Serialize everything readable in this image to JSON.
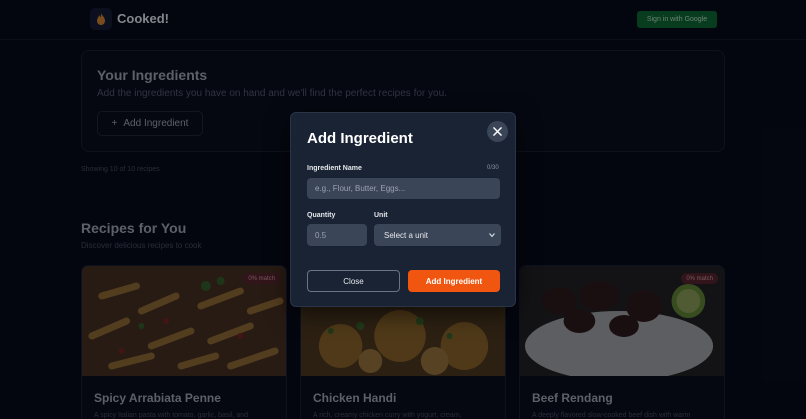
{
  "app": {
    "brand": "Cooked!",
    "signin_label": "Sign in with Google"
  },
  "ingredients": {
    "title": "Your Ingredients",
    "subtitle": "Add the ingredients you have on hand and we'll find the perfect recipes for you.",
    "add_label": "Add Ingredient",
    "showing": "Showing 10 of 10 recipes"
  },
  "recipes": {
    "title": "Recipes for You",
    "subtitle": "Discover delicious recipes to cook",
    "items": [
      {
        "name": "Spicy Arrabiata Penne",
        "desc": "A spicy Italian pasta with tomato, garlic, basil, and",
        "match": "0% match"
      },
      {
        "name": "Chicken Handi",
        "desc": "A rich, creamy chicken curry with yogurt, cream,",
        "match": ""
      },
      {
        "name": "Beef Rendang",
        "desc": "A deeply flavored slow-cooked beef dish with warm",
        "match": "0% match"
      }
    ]
  },
  "modal": {
    "title": "Add Ingredient",
    "name_label": "Ingredient Name",
    "name_counter": "0/30",
    "name_placeholder": "e.g., Flour, Butter, Eggs...",
    "quantity_label": "Quantity",
    "quantity_placeholder": "0.5",
    "unit_label": "Unit",
    "unit_value": "Select a unit",
    "close_label": "Close",
    "submit_label": "Add Ingredient"
  },
  "colors": {
    "accent": "#f0560f",
    "signin_bg": "#0a5b2a",
    "modal_bg": "#1a2334"
  }
}
